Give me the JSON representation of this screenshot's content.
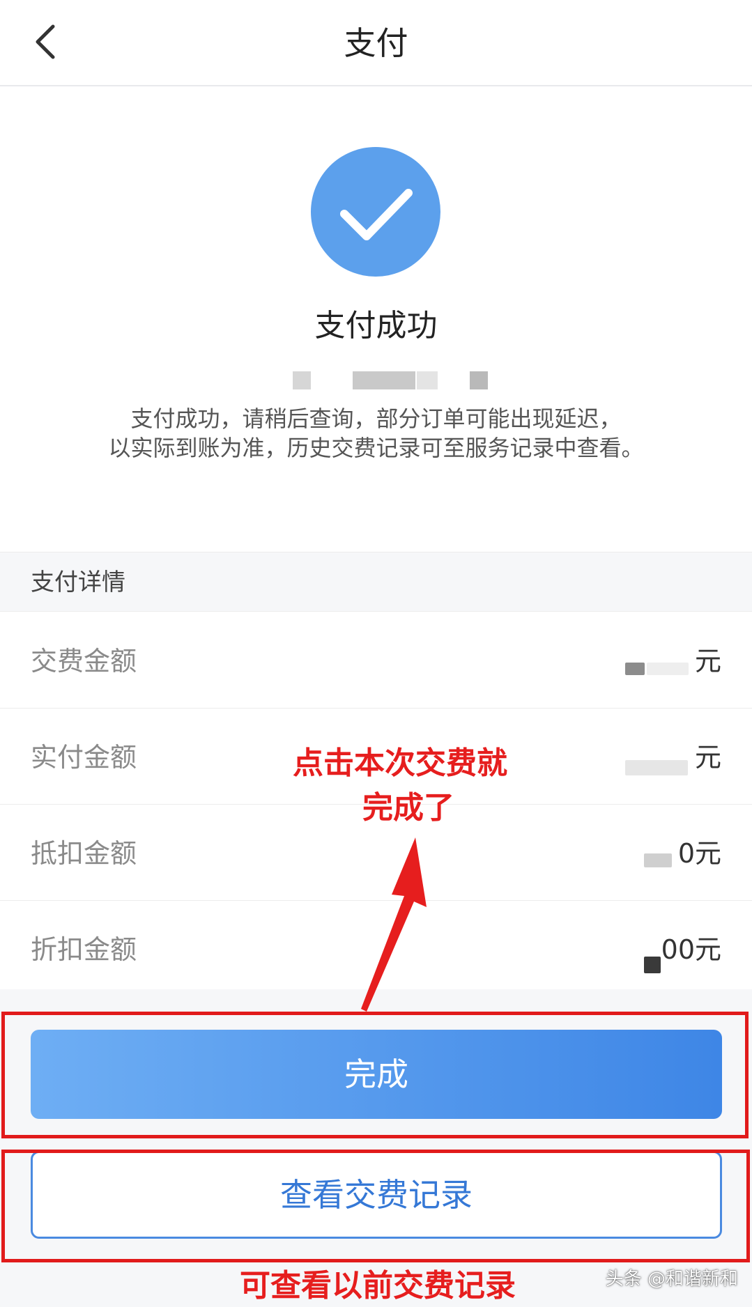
{
  "header": {
    "title": "支付"
  },
  "success": {
    "title": "支付成功",
    "description_lines": [
      "支付成功，请稍后查询，部分订单可能出现延迟，",
      "以实际到账为准，历史交费记录可至服务记录中查看。"
    ]
  },
  "details": {
    "section_title": "支付详情",
    "rows": [
      {
        "label": "交费金额",
        "value": "元"
      },
      {
        "label": "实付金额",
        "value": "元"
      },
      {
        "label": "抵扣金额",
        "value": "0元"
      },
      {
        "label": "折扣金额",
        "value": "00元"
      }
    ]
  },
  "buttons": {
    "done_label": "完成",
    "records_label": "查看交费记录"
  },
  "annotations": {
    "done_hint_line1": "点击本次交费就",
    "done_hint_line2": "完成了",
    "records_hint": "可查看以前交费记录",
    "color": "#e11b1b"
  },
  "watermark": "头条 @和谐新和",
  "colors": {
    "accent": "#4a90e2",
    "success_circle": "#5ca0ec",
    "annotation_red": "#e11b1b"
  }
}
